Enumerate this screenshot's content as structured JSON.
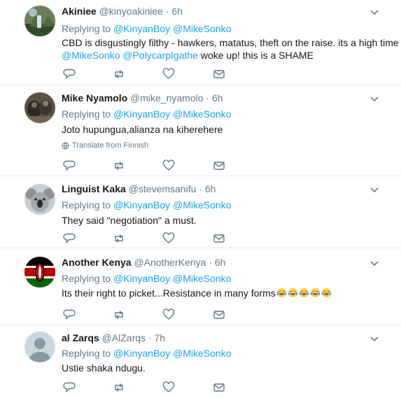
{
  "replying_label": "Replying to",
  "translate_label": "Translate from Finnish",
  "tweets": [
    {
      "name": "Akiniee",
      "handle": "@kinyoakiniee",
      "time": "6h",
      "replying_to": [
        "@KinyanBoy",
        "@MikeSonko"
      ],
      "text_line1": "CBD is disgustingly filthy - hawkers, matatus, theft on the raise. its a high time",
      "text_mention1": "@MikeSonko",
      "text_mention2": "@PolycarpIgathe",
      "text_tail": "woke up! this is a SHAME"
    },
    {
      "name": "Mike Nyamolo",
      "handle": "@mike_nyamolo",
      "time": "6h",
      "replying_to": [
        "@KinyanBoy",
        "@MikeSonko"
      ],
      "text": "Joto hupungua,alianza na kiherehere"
    },
    {
      "name": "Linguist Kaka",
      "handle": "@stevemsanifu",
      "time": "6h",
      "replying_to": [
        "@KinyanBoy",
        "@MikeSonko"
      ],
      "text": "They said \"negotiation\" a must."
    },
    {
      "name": "Another Kenya",
      "handle": "@AnotherKenya",
      "time": "6h",
      "replying_to": [
        "@KinyanBoy",
        "@MikeSonko"
      ],
      "text": "Its their right to picket...Resistance in many forms",
      "emoji_count": 5
    },
    {
      "name": "al Zarqs",
      "handle": "@AlZarqs",
      "time": "7h",
      "replying_to": [
        "@KinyanBoy",
        "@MikeSonko"
      ],
      "text": "Ustie shaka ndugu."
    }
  ],
  "colors": {
    "link": "#1da1f2",
    "secondary": "#657786",
    "border": "#e6ecf0"
  }
}
